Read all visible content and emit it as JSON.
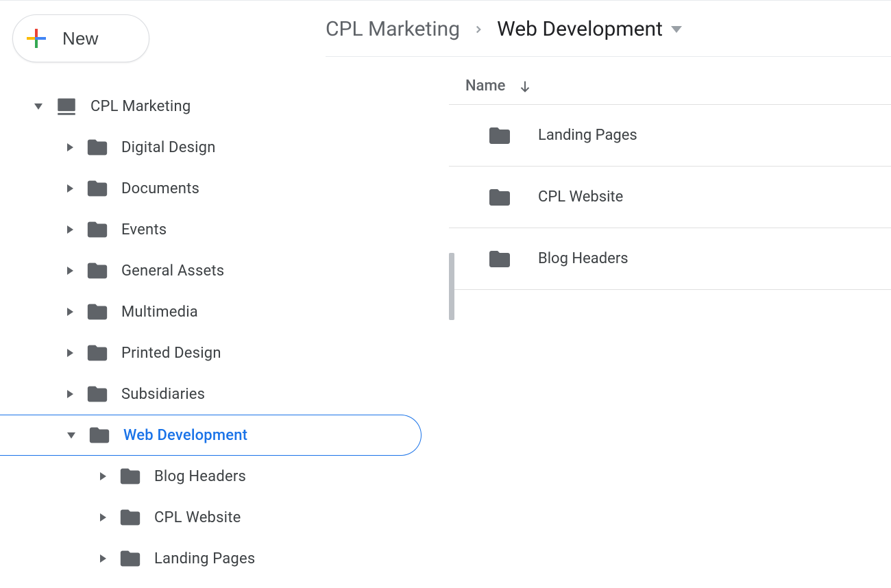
{
  "sidebar": {
    "new_label": "New",
    "root": {
      "label": "CPL Marketing",
      "children": [
        {
          "label": "Digital Design"
        },
        {
          "label": "Documents"
        },
        {
          "label": "Events"
        },
        {
          "label": "General Assets"
        },
        {
          "label": "Multimedia"
        },
        {
          "label": "Printed Design"
        },
        {
          "label": "Subsidiaries"
        },
        {
          "label": "Web Development",
          "active": true,
          "children": [
            {
              "label": "Blog Headers"
            },
            {
              "label": "CPL Website"
            },
            {
              "label": "Landing Pages"
            }
          ]
        }
      ]
    }
  },
  "breadcrumb": {
    "parent": "CPL Marketing",
    "current": "Web Development"
  },
  "list": {
    "column_name": "Name",
    "items": [
      {
        "name": "Landing Pages"
      },
      {
        "name": "CPL Website"
      },
      {
        "name": "Blog Headers"
      }
    ]
  }
}
